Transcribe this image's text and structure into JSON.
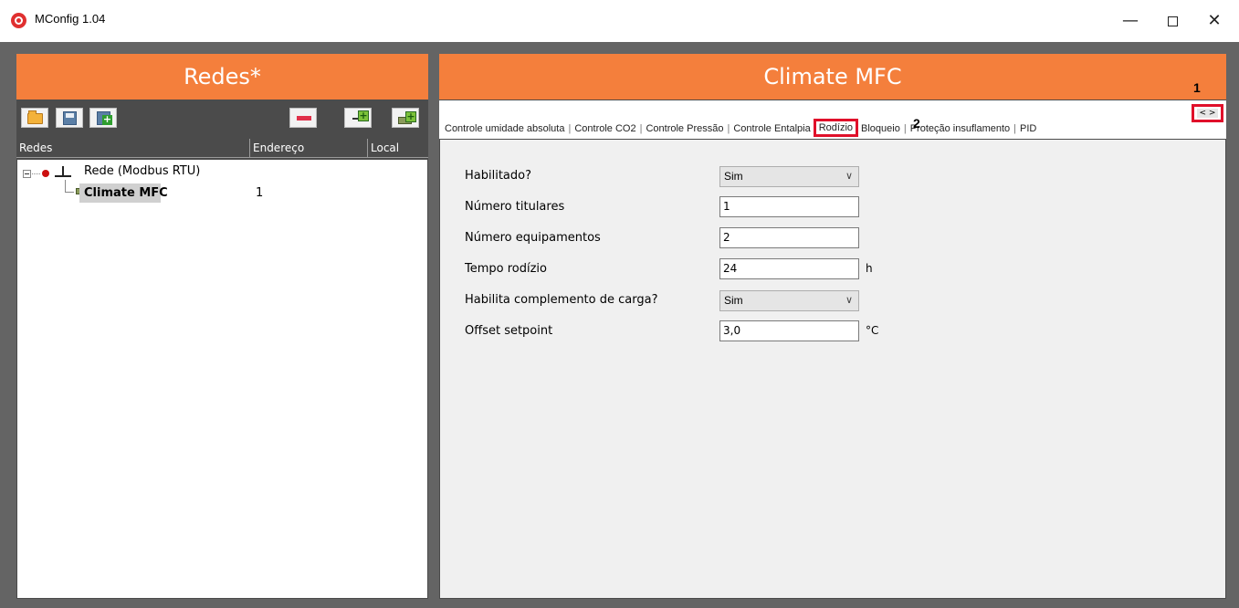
{
  "window": {
    "title": "MConfig 1.04",
    "minimize_glyph": "—",
    "close_glyph": "✕"
  },
  "left_panel": {
    "title": "Redes*",
    "toolbar_icons": [
      "open-folder-icon",
      "save-icon",
      "save-as-icon",
      "remove-icon",
      "add-network-icon",
      "add-device-icon"
    ],
    "columns": [
      "Redes",
      "Endereço",
      "Local"
    ],
    "tree": {
      "network": {
        "label": "Rede (Modbus RTU)"
      },
      "device": {
        "label": "Climate MFC",
        "address": "1"
      }
    }
  },
  "right_panel": {
    "title": "Climate MFC",
    "tabs": [
      "Controle umidade absoluta",
      "Controle CO2",
      "Controle Pressão",
      "Controle Entalpia",
      "Rodízio",
      "Bloqueio",
      "Proteção insuflamento",
      "PID"
    ],
    "active_tab": "Rodízio",
    "tab_nav_label": "< >",
    "annotations": {
      "nav": "1",
      "tab": "2"
    },
    "form": {
      "habilitado": {
        "label": "Habilitado?",
        "value": "Sim"
      },
      "numero_titulares": {
        "label": "Número titulares",
        "value": "1"
      },
      "numero_equipamentos": {
        "label": "Número equipamentos",
        "value": "2"
      },
      "tempo_rodizio": {
        "label": "Tempo rodízio",
        "value": "24",
        "unit": "h"
      },
      "habilita_complemento": {
        "label": "Habilita complemento de carga?",
        "value": "Sim"
      },
      "offset_setpoint": {
        "label": "Offset setpoint",
        "value": "3,0",
        "unit": "°C"
      }
    }
  },
  "colors": {
    "header_orange": "#f47f3c",
    "panel_dark": "#4b4b4b",
    "background_gray": "#646464",
    "annotation_red": "#e0102a"
  }
}
